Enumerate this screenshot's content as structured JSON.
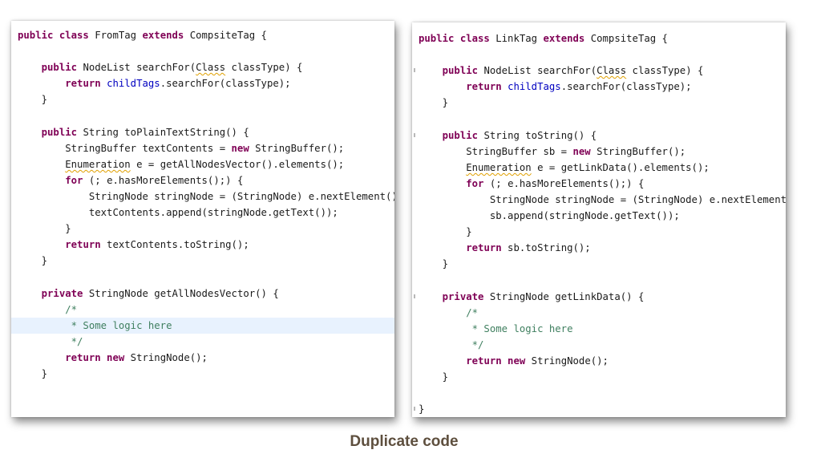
{
  "caption": "Duplicate code",
  "colors": {
    "keyword": "#7f0055",
    "field": "#0000c0",
    "comment": "#3f7f5f",
    "highlight": "#e8f2fe",
    "caption": "#5e4f3e"
  },
  "left_panel": {
    "class_name": "FromTag",
    "highlighted_line": 18,
    "lines": [
      [
        {
          "t": "public class",
          "k": "kw"
        },
        {
          "t": " FromTag "
        },
        {
          "t": "extends",
          "k": "kw"
        },
        {
          "t": " CompsiteTag {"
        }
      ],
      [],
      [
        {
          "t": "    "
        },
        {
          "t": "public",
          "k": "kw"
        },
        {
          "t": " NodeList searchFor("
        },
        {
          "t": "Class",
          "k": "squig"
        },
        {
          "t": " classType) {"
        }
      ],
      [
        {
          "t": "        "
        },
        {
          "t": "return",
          "k": "kw"
        },
        {
          "t": " "
        },
        {
          "t": "childTags",
          "k": "field"
        },
        {
          "t": ".searchFor(classType);"
        }
      ],
      [
        {
          "t": "    }"
        }
      ],
      [],
      [
        {
          "t": "    "
        },
        {
          "t": "public",
          "k": "kw"
        },
        {
          "t": " String toPlainTextString() {"
        }
      ],
      [
        {
          "t": "        StringBuffer textContents = "
        },
        {
          "t": "new",
          "k": "kw"
        },
        {
          "t": " StringBuffer();"
        }
      ],
      [
        {
          "t": "        "
        },
        {
          "t": "Enumeration",
          "k": "squig"
        },
        {
          "t": " e = getAllNodesVector().elements();"
        }
      ],
      [
        {
          "t": "        "
        },
        {
          "t": "for",
          "k": "kw"
        },
        {
          "t": " (; e.hasMoreElements();) {"
        }
      ],
      [
        {
          "t": "            StringNode stringNode = (StringNode) e.nextElement();"
        }
      ],
      [
        {
          "t": "            textContents.append(stringNode.getText());"
        }
      ],
      [
        {
          "t": "        }"
        }
      ],
      [
        {
          "t": "        "
        },
        {
          "t": "return",
          "k": "kw"
        },
        {
          "t": " textContents.toString();"
        }
      ],
      [
        {
          "t": "    }"
        }
      ],
      [],
      [
        {
          "t": "    "
        },
        {
          "t": "private",
          "k": "kw"
        },
        {
          "t": " StringNode getAllNodesVector() {"
        }
      ],
      [
        {
          "t": "        /*",
          "k": "cm"
        }
      ],
      [
        {
          "t": "         * Some logic here",
          "k": "cm"
        }
      ],
      [
        {
          "t": "         */",
          "k": "cm"
        }
      ],
      [
        {
          "t": "        "
        },
        {
          "t": "return new",
          "k": "kw"
        },
        {
          "t": " StringNode();"
        }
      ],
      [
        {
          "t": "    }"
        }
      ],
      [],
      [],
      [
        {
          "t": "}"
        }
      ]
    ]
  },
  "right_panel": {
    "class_name": "LinkTag",
    "highlighted_line": -1,
    "lines": [
      [
        {
          "t": "public class",
          "k": "kw"
        },
        {
          "t": " LinkTag "
        },
        {
          "t": "extends",
          "k": "kw"
        },
        {
          "t": " CompsiteTag {"
        }
      ],
      [],
      [
        {
          "t": "    "
        },
        {
          "t": "public",
          "k": "kw"
        },
        {
          "t": " NodeList searchFor("
        },
        {
          "t": "Class",
          "k": "squig"
        },
        {
          "t": " classType) {"
        }
      ],
      [
        {
          "t": "        "
        },
        {
          "t": "return",
          "k": "kw"
        },
        {
          "t": " "
        },
        {
          "t": "childTags",
          "k": "field"
        },
        {
          "t": ".searchFor(classType);"
        }
      ],
      [
        {
          "t": "    }"
        }
      ],
      [],
      [
        {
          "t": "    "
        },
        {
          "t": "public",
          "k": "kw"
        },
        {
          "t": " String toString() {"
        }
      ],
      [
        {
          "t": "        StringBuffer sb = "
        },
        {
          "t": "new",
          "k": "kw"
        },
        {
          "t": " StringBuffer();"
        }
      ],
      [
        {
          "t": "        "
        },
        {
          "t": "Enumeration",
          "k": "squig"
        },
        {
          "t": " e = getLinkData().elements();"
        }
      ],
      [
        {
          "t": "        "
        },
        {
          "t": "for",
          "k": "kw"
        },
        {
          "t": " (; e.hasMoreElements();) {"
        }
      ],
      [
        {
          "t": "            StringNode stringNode = (StringNode) e.nextElement();"
        }
      ],
      [
        {
          "t": "            sb.append(stringNode.getText());"
        }
      ],
      [
        {
          "t": "        }"
        }
      ],
      [
        {
          "t": "        "
        },
        {
          "t": "return",
          "k": "kw"
        },
        {
          "t": " sb.toString();"
        }
      ],
      [
        {
          "t": "    }"
        }
      ],
      [],
      [
        {
          "t": "    "
        },
        {
          "t": "private",
          "k": "kw"
        },
        {
          "t": " StringNode getLinkData() {"
        }
      ],
      [
        {
          "t": "        /*",
          "k": "cm"
        }
      ],
      [
        {
          "t": "         * Some logic here",
          "k": "cm"
        }
      ],
      [
        {
          "t": "         */",
          "k": "cm"
        }
      ],
      [
        {
          "t": "        "
        },
        {
          "t": "return new",
          "k": "kw"
        },
        {
          "t": " StringNode();"
        }
      ],
      [
        {
          "t": "    }"
        }
      ],
      [],
      [
        {
          "t": "}"
        }
      ]
    ]
  }
}
